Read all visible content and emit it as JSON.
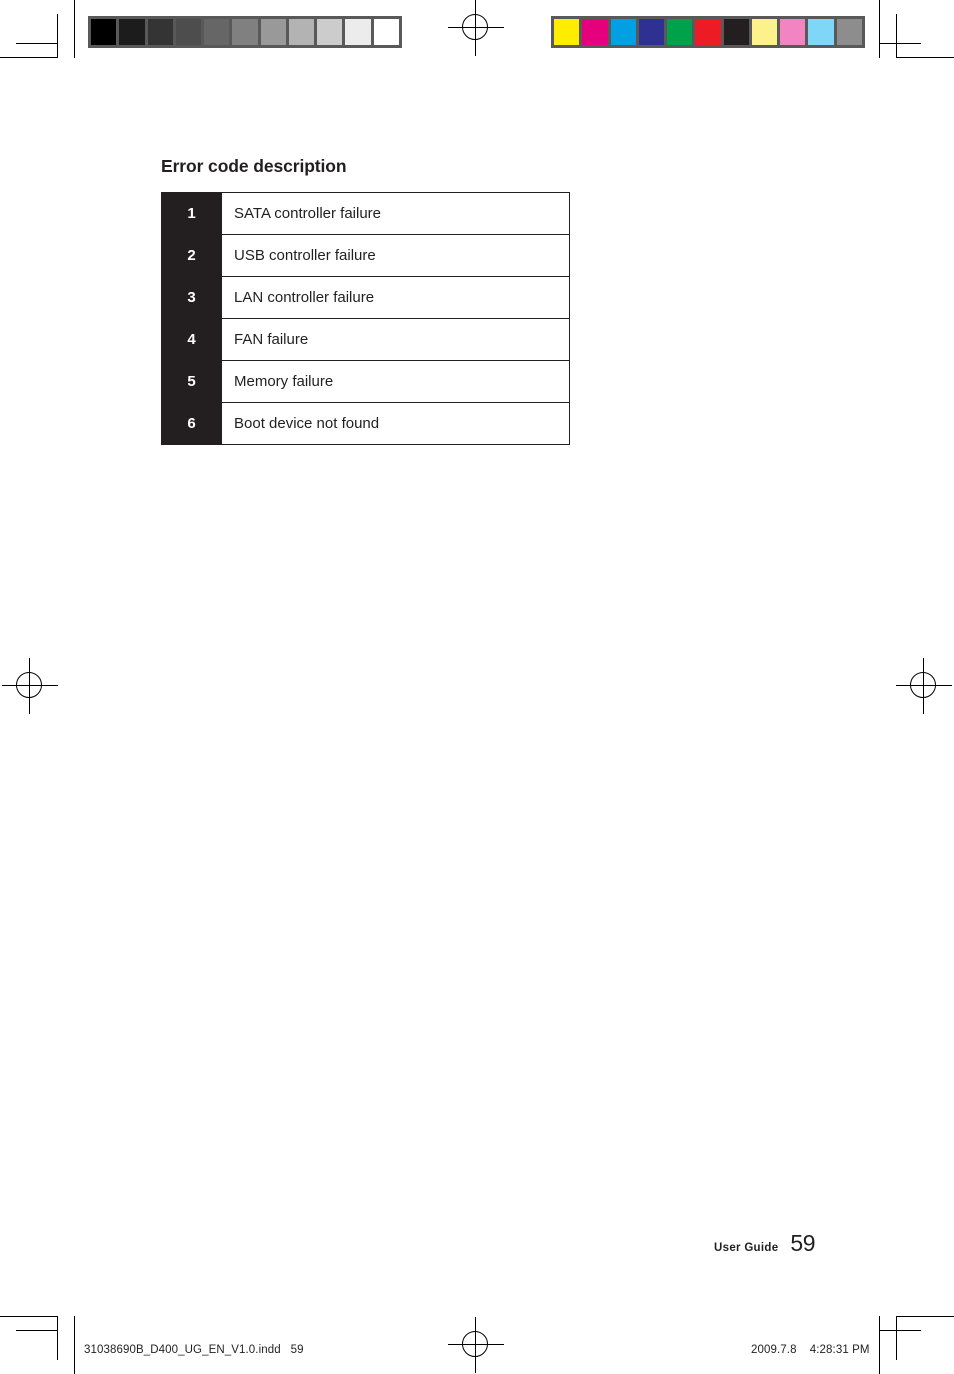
{
  "page": {
    "heading": "Error code description",
    "footer": {
      "label": "User Guide",
      "page_number": "59"
    }
  },
  "table": {
    "rows": [
      {
        "code": "1",
        "description": "SATA controller failure"
      },
      {
        "code": "2",
        "description": "USB controller failure"
      },
      {
        "code": "3",
        "description": "LAN controller failure"
      },
      {
        "code": "4",
        "description": "FAN failure"
      },
      {
        "code": "5",
        "description": "Memory failure"
      },
      {
        "code": "6",
        "description": "Boot device not found"
      }
    ]
  },
  "print_info": {
    "filename": "31038690B_D400_UG_EN_V1.0.indd   59",
    "timestamp": "2009.7.8    4:28:31 PM"
  },
  "calibration": {
    "grayscale_label": "grayscale-step-wedge",
    "grayscale_swatches": [
      "#000000",
      "#1c1c1c",
      "#343434",
      "#4d4d4d",
      "#666666",
      "#808080",
      "#999999",
      "#b3b3b3",
      "#cccccc",
      "#ececec",
      "#ffffff"
    ],
    "color_label": "process-color-bar",
    "color_swatches": [
      "#ffed00",
      "#e6007e",
      "#00a0e3",
      "#2e3192",
      "#00a14b",
      "#ed1c24",
      "#231f20",
      "#fdf18c",
      "#f285c1",
      "#7fd6f7",
      "#8d8d8d"
    ]
  },
  "marks": {
    "registration_label": "registration-target",
    "crop_label": "crop-mark"
  }
}
